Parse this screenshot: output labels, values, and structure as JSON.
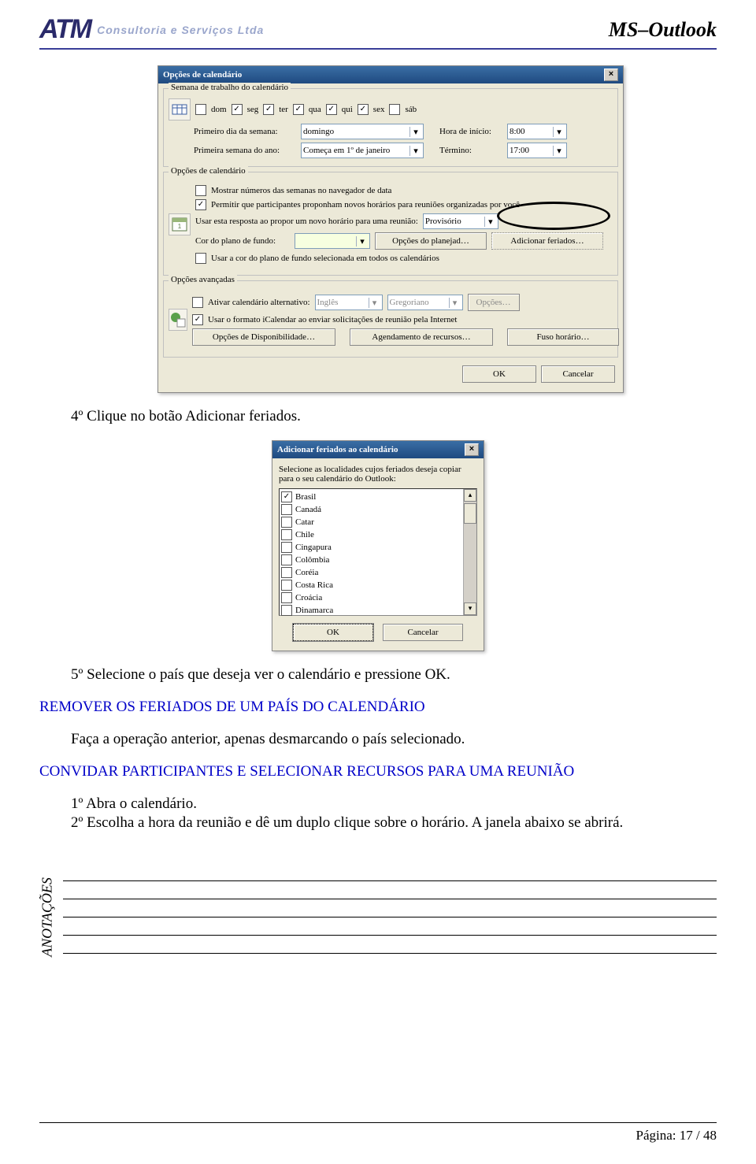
{
  "header": {
    "logo_text": "ATM",
    "logo_tag": "Consultoria e Serviços Ltda",
    "doc_title": "MS–Outlook"
  },
  "dlg1": {
    "title": "Opções de calendário",
    "grp_week": "Semana de trabalho do calendário",
    "days": {
      "dom": "dom",
      "seg": "seg",
      "ter": "ter",
      "qua": "qua",
      "qui": "qui",
      "sex": "sex",
      "sab": "sáb"
    },
    "lbl_firstday": "Primeiro dia da semana:",
    "val_firstday": "domingo",
    "lbl_start": "Hora de início:",
    "val_start": "8:00",
    "lbl_firstweek": "Primeira semana do ano:",
    "val_firstweek": "Começa em 1º de janeiro",
    "lbl_end": "Término:",
    "val_end": "17:00",
    "grp_opts": "Opções de calendário",
    "chk_weeknums": "Mostrar números das semanas no navegador de data",
    "chk_propose": "Permitir que participantes proponham novos horários para reuniões organizadas por você",
    "lbl_response": "Usar esta resposta ao propor um novo horário para uma reunião:",
    "val_response": "Provisório",
    "lbl_bgcolor": "Cor do plano de fundo:",
    "btn_plan": "Opções do planejad…",
    "btn_holidays": "Adicionar feriados…",
    "chk_bgall": "Usar a cor do plano de fundo selecionada em todos os calendários",
    "grp_adv": "Opções avançadas",
    "chk_altcal": "Ativar calendário alternativo:",
    "val_lang": "Inglês",
    "val_cal": "Gregoriano",
    "btn_opts": "Opções…",
    "chk_ical": "Usar o formato iCalendar ao enviar solicitações de reunião pela Internet",
    "btn_avail": "Opções de Disponibilidade…",
    "btn_res": "Agendamento de recursos…",
    "btn_tz": "Fuso horário…",
    "btn_ok": "OK",
    "btn_cancel": "Cancelar"
  },
  "step4": "4º Clique no botão Adicionar feriados.",
  "dlg2": {
    "title": "Adicionar feriados ao calendário",
    "intro": "Selecione as localidades cujos feriados deseja copiar para o seu calendário do Outlook:",
    "countries": [
      "Brasil",
      "Canadá",
      "Catar",
      "Chile",
      "Cingapura",
      "Colômbia",
      "Coréia",
      "Costa Rica",
      "Croácia",
      "Dinamarca"
    ],
    "btn_ok": "OK",
    "btn_cancel": "Cancelar"
  },
  "step5": "5º Selecione o país que deseja ver o calendário e pressione OK.",
  "h_remove": "REMOVER OS FERIADOS DE UM PAÍS DO CALENDÁRIO",
  "p_remove": "Faça a operação anterior, apenas desmarcando o país selecionado.",
  "h_invite": "CONVIDAR PARTICIPANTES E SELECIONAR RECURSOS PARA UMA REUNIÃO",
  "step1b": "1º Abra o calendário.",
  "step2b": "2º Escolha a hora da reunião e dê um duplo clique sobre o horário. A janela abaixo se abrirá.",
  "annot_label": "ANOTAÇÕES",
  "footer": "Página: 17 / 48"
}
